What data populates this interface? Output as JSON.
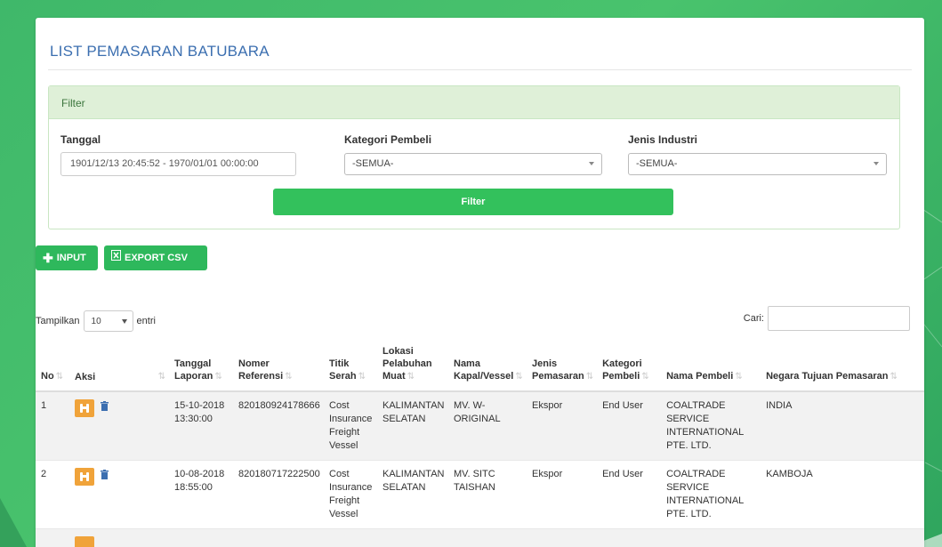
{
  "page": {
    "title": "LIST PEMASARAN BATUBARA"
  },
  "filter": {
    "heading": "Filter",
    "tanggal_label": "Tanggal",
    "tanggal_value": "1901/12/13 20:45:52 - 1970/01/01 00:00:00",
    "kategori_label": "Kategori Pembeli",
    "kategori_value": "-SEMUA-",
    "industri_label": "Jenis Industri",
    "industri_value": "-SEMUA-",
    "button_label": "Filter"
  },
  "toolbar": {
    "input_label": "INPUT",
    "export_label": "EXPORT CSV"
  },
  "table_controls": {
    "show_prefix": "Tampilkan",
    "show_value": "10",
    "show_suffix": "entri",
    "search_label": "Cari:"
  },
  "table": {
    "headers": [
      "No",
      "Aksi",
      "Tanggal Laporan",
      "Nomer Referensi",
      "Titik Serah",
      "Lokasi Pelabuhan Muat",
      "Nama Kapal/Vessel",
      "Jenis Pemasaran",
      "Kategori Pembeli",
      "Nama Pembeli",
      "Negara Tujuan Pemasaran"
    ],
    "rows": [
      {
        "no": "1",
        "tanggal": "15-10-2018 13:30:00",
        "nomer": "820180924178666",
        "titik": "Cost Insurance Freight Vessel",
        "lokasi": "KALIMANTAN SELATAN",
        "kapal": "MV. W-ORIGINAL",
        "jenis": "Ekspor",
        "kategori": "End User",
        "pembeli": "COALTRADE SERVICE INTERNATIONAL PTE. LTD.",
        "negara": "INDIA"
      },
      {
        "no": "2",
        "tanggal": "10-08-2018 18:55:00",
        "nomer": "820180717222500",
        "titik": "Cost Insurance Freight Vessel",
        "lokasi": "KALIMANTAN SELATAN",
        "kapal": "MV. SITC TAISHAN",
        "jenis": "Ekspor",
        "kategori": "End User",
        "pembeli": "COALTRADE SERVICE INTERNATIONAL PTE. LTD.",
        "negara": "KAMBOJA"
      }
    ]
  },
  "colors": {
    "accent_green": "#2eb85c",
    "title_blue": "#3c6fb0",
    "action_orange": "#f0a33a",
    "trash_blue": "#3c6fb0"
  }
}
